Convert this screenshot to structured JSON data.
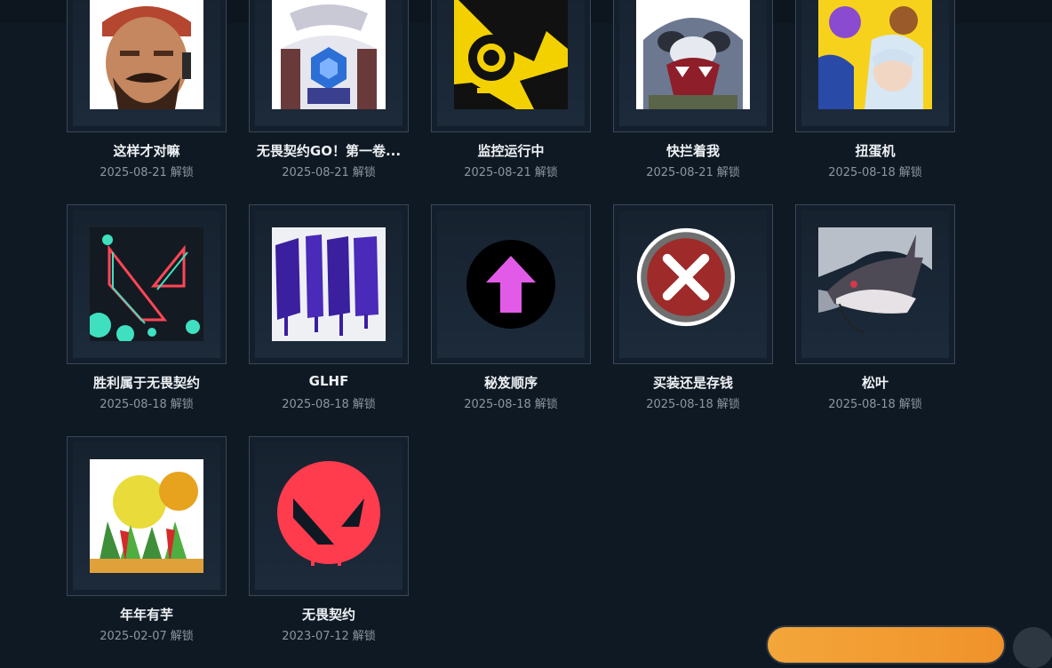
{
  "cards": [
    {
      "title": "这样才对嘛",
      "date": "2025-08-21",
      "unlock": "解锁",
      "art": "bearded-agent-icon"
    },
    {
      "title": "无畏契约GO！第一卷...",
      "date": "2025-08-21",
      "unlock": "解锁",
      "art": "armored-agent-icon"
    },
    {
      "title": "监控运行中",
      "date": "2025-08-21",
      "unlock": "解锁",
      "art": "robot-camera-icon"
    },
    {
      "title": "快拦着我",
      "date": "2025-08-21",
      "unlock": "解锁",
      "art": "shouting-panda-icon"
    },
    {
      "title": "扭蛋机",
      "date": "2025-08-18",
      "unlock": "解锁",
      "art": "gacha-agents-icon"
    },
    {
      "title": "胜利属于无畏契约",
      "date": "2025-08-18",
      "unlock": "解锁",
      "art": "valorant-logo-splatter-icon"
    },
    {
      "title": "GLHF",
      "date": "2025-08-18",
      "unlock": "解锁",
      "art": "glhf-graffiti-icon"
    },
    {
      "title": "秘笈顺序",
      "date": "2025-08-18",
      "unlock": "解锁",
      "art": "up-arrow-icon"
    },
    {
      "title": "买装还是存钱",
      "date": "2025-08-18",
      "unlock": "解锁",
      "art": "red-x-button-icon"
    },
    {
      "title": "松叶",
      "date": "2025-08-18",
      "unlock": "解锁",
      "art": "catfish-icon"
    },
    {
      "title": "年年有芋",
      "date": "2025-02-07",
      "unlock": "解锁",
      "art": "fruit-basket-icon"
    },
    {
      "title": "无畏契约",
      "date": "2023-07-12",
      "unlock": "解锁",
      "art": "valorant-red-logo-icon"
    }
  ],
  "colors": {
    "background": "#0f1923",
    "card_border": "#3a4756",
    "title": "#eef1f4",
    "date": "#8c96a1",
    "accent_orange": "#f3a63a"
  }
}
